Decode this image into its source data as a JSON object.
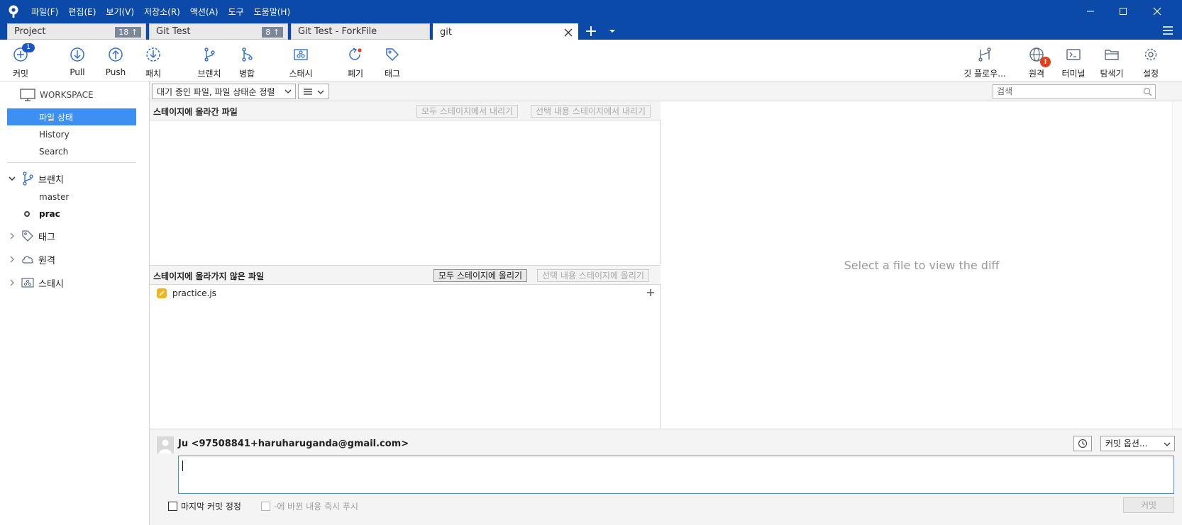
{
  "menu": [
    "파일(F)",
    "편집(E)",
    "보기(V)",
    "저장소(R)",
    "액션(A)",
    "도구",
    "도움말(H)"
  ],
  "tabs": [
    {
      "label": "Project",
      "badge": "18 ↑"
    },
    {
      "label": "Git Test",
      "badge": "8 ↑"
    },
    {
      "label": "Git Test - ForkFile",
      "badge": ""
    },
    {
      "label": "git",
      "badge": ""
    }
  ],
  "toolbar": {
    "commit": "커밋",
    "commit_badge": "1",
    "pull": "Pull",
    "push": "Push",
    "patch": "패치",
    "branch": "브랜치",
    "merge": "병합",
    "stash": "스태시",
    "discard": "폐기",
    "tag": "태그",
    "gitflow": "깃 플로우...",
    "remote": "원격",
    "remote_badge": "!",
    "terminal": "터미널",
    "explorer": "탐색기",
    "settings": "설정"
  },
  "sidebar": {
    "workspace_title": "WORKSPACE",
    "items": [
      "파일 상태",
      "History",
      "Search"
    ],
    "branches_label": "브랜치",
    "branches": [
      {
        "name": "master",
        "current": false
      },
      {
        "name": "prac",
        "current": true
      }
    ],
    "tags_label": "태그",
    "remotes_label": "원격",
    "stashes_label": "스태시"
  },
  "filterbar": {
    "sort_label": "대기 중인 파일, 파일 상태순 정렬",
    "view_icon": "list-icon",
    "search_placeholder": "검색"
  },
  "staged": {
    "title": "스테이지에 올라간 파일",
    "unstage_all": "모두 스테이지에서 내리기",
    "unstage_selected": "선택 내용 스테이지에서 내리기"
  },
  "unstaged": {
    "title": "스테이지에 올라가지 않은 파일",
    "stage_all": "모두 스테이지에 올리기",
    "stage_selected": "선택 내용 스테이지에 올리기",
    "files": [
      "practice.js"
    ]
  },
  "diff": {
    "placeholder": "Select a file to view the diff"
  },
  "commit": {
    "author": "Ju <97508841+haruharuganda@gmail.com>",
    "options_label": "커밋 옵션...",
    "amend_label": "마지막 커밋 정정",
    "push_label": "-에 바뀐 내용 즉시 푸시",
    "commit_button": "커밋",
    "message": ""
  },
  "colors": {
    "titlebar": "#0b4aa8",
    "selection": "#3d8ff1",
    "badge": "#1b57c4",
    "alert": "#e2401c",
    "modified_file": "#f3b51f"
  }
}
